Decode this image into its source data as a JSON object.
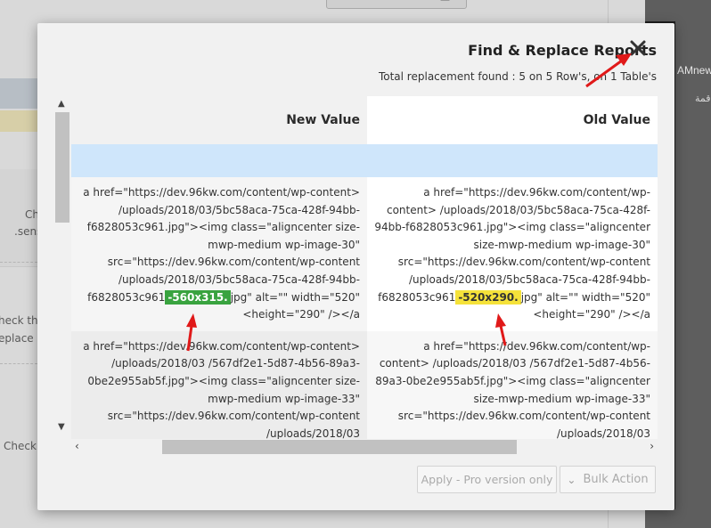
{
  "background": {
    "left_texts": [
      "Ch",
      ".sens",
      "heck this",
      "eplace -",
      "Check"
    ],
    "right_texts": [
      "AMnew",
      "قمة"
    ]
  },
  "modal": {
    "title": "Find & Replace Reports",
    "summary": "Total replacement found : 5 on 5 Row's, on 1 Table's",
    "columns": {
      "new": "New Value",
      "old": "Old Value"
    },
    "rows": [
      {
        "new": {
          "before": "a href=\"https://dev.96kw.com/content/wp-content> /uploads/2018/03/5bc58aca-75ca-428f-94bb-f6828053c961.jpg\"><img class=\"aligncenter size-mwp-medium wp-image-30\" src=\"https://dev.96kw.com/content/wp-content /uploads/2018/03/5bc58aca-75ca-428f-94bb-f6828053c961",
          "highlight": "-560x315.",
          "after": "jpg\" alt=\"\" width=\"520\" <height=\"290\" /></a"
        },
        "old": {
          "before": "a href=\"https://dev.96kw.com/content/wp-content> /uploads/2018/03/5bc58aca-75ca-428f-94bb-f6828053c961.jpg\"><img class=\"aligncenter size-mwp-medium wp-image-30\" src=\"https://dev.96kw.com/content/wp-content /uploads/2018/03/5bc58aca-75ca-428f-94bb-f6828053c961",
          "highlight": "-520x290.",
          "after": "jpg\" alt=\"\" width=\"520\" <height=\"290\" /></a"
        }
      },
      {
        "new": {
          "text": "a href=\"https://dev.96kw.com/content/wp-content> /uploads/2018/03 /567df2e1-5d87-4b56-89a3-0be2e955ab5f.jpg\"><img class=\"aligncenter size-mwp-medium wp-image-33\" src=\"https://dev.96kw.com/content/wp-content /uploads/2018/03"
        },
        "old": {
          "text": "a href=\"https://dev.96kw.com/content/wp-content> /uploads/2018/03 /567df2e1-5d87-4b56-89a3-0be2e955ab5f.jpg\"><img class=\"aligncenter size-mwp-medium wp-image-33\" src=\"https://dev.96kw.com/content/wp-content /uploads/2018/03"
        }
      }
    ],
    "buttons": {
      "apply": "Apply - Pro version only",
      "bulk": "Bulk Action"
    }
  },
  "colors": {
    "highlight_new": "#39a33f",
    "highlight_old": "#f5e23a",
    "header_row_blue": "#cfe6fb",
    "annotation_arrow": "#e01919"
  }
}
